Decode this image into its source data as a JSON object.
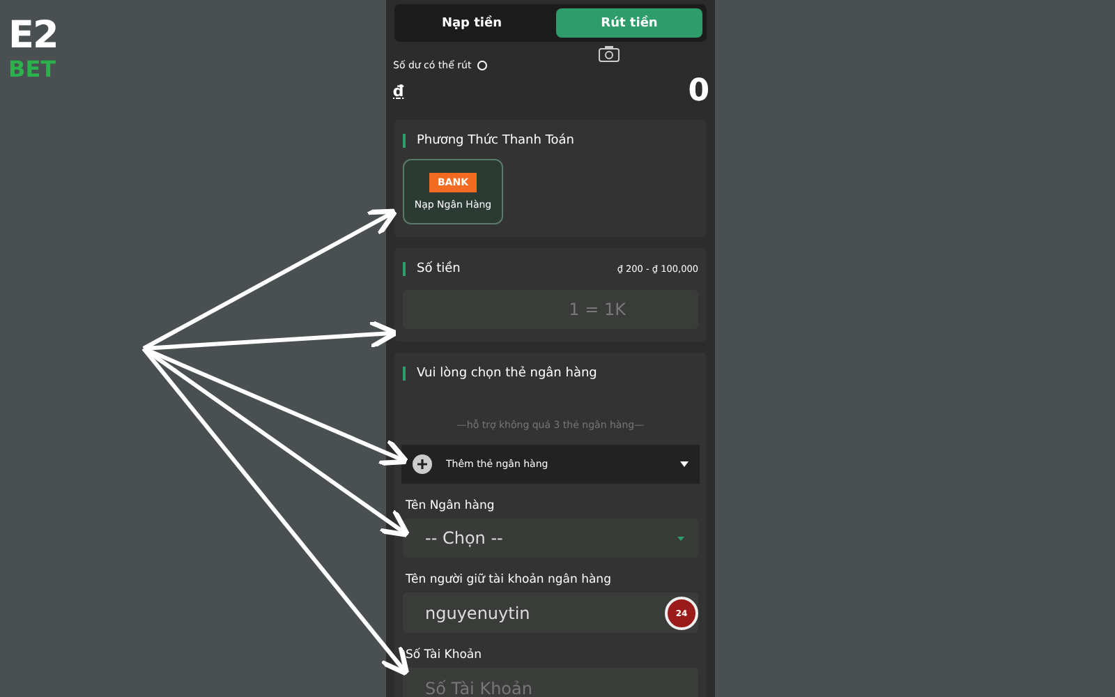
{
  "logo": {
    "top": "E2",
    "bottom": "BET"
  },
  "tabs": [
    {
      "label": "Nạp tiền",
      "selected": false
    },
    {
      "label": "Rút tiền",
      "selected": true
    }
  ],
  "balance": {
    "label": "Số dư có thể rút",
    "currency": "₫",
    "amount": "0"
  },
  "payment": {
    "title": "Phương Thức Thanh Toán",
    "methods": [
      {
        "logo": "BANK",
        "label": "Nạp Ngân Hàng",
        "selected": true
      }
    ]
  },
  "amount": {
    "title": "Số tiền",
    "range": "₫ 200 - ₫ 100,000",
    "placeholder": "1 = 1K"
  },
  "bank_card": {
    "title": "Vui lòng chọn thẻ ngân hàng",
    "note": "—hỗ trợ không quá 3 thẻ ngân hàng—",
    "add_label": "Thêm thẻ ngân hàng",
    "fields": [
      {
        "kind": "select",
        "label": "Tên Ngân hàng",
        "value": "-- Chọn --"
      },
      {
        "kind": "input",
        "label": "Tên người giữ tài khoản ngân hàng",
        "value": "nguyenuytin"
      },
      {
        "kind": "input",
        "label": "Số Tài Khoản",
        "placeholder": "Số Tài Khoản"
      }
    ]
  },
  "support_badge": "24"
}
